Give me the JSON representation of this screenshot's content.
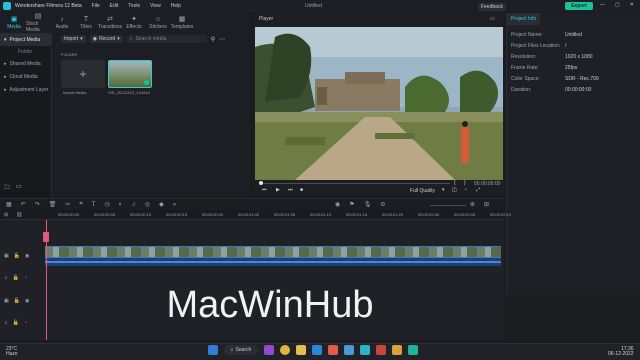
{
  "titlebar": {
    "app_name": "Wondershare Filmora 12 Beta",
    "menu": [
      "File",
      "Edit",
      "Tools",
      "View",
      "Help"
    ],
    "doc_title": "Untitled",
    "feedback": "Feedback",
    "export": "Export",
    "accent": "#17c39a"
  },
  "toptabs": [
    {
      "label": "Media",
      "icon": "media-icon"
    },
    {
      "label": "Stock Media",
      "icon": "stock-media-icon"
    },
    {
      "label": "Audio",
      "icon": "music-note-icon"
    },
    {
      "label": "Titles",
      "icon": "text-icon"
    },
    {
      "label": "Transitions",
      "icon": "transition-icon"
    },
    {
      "label": "Effects",
      "icon": "effects-icon"
    },
    {
      "label": "Stickers",
      "icon": "sticker-icon"
    },
    {
      "label": "Templates",
      "icon": "template-icon"
    }
  ],
  "leftnav": {
    "project_media": "Project Media",
    "folder": "Folder",
    "shared_media": "Shared Media",
    "cloud_media": "Cloud Media",
    "adjustment_layer": "Adjustment Layer"
  },
  "media": {
    "import_btn": "Import",
    "record_btn": "Record",
    "search_placeholder": "Search media",
    "folder_label": "FOLDER",
    "import_tile_label": "Import Media",
    "clip_label": "VID_20221112_144416"
  },
  "player": {
    "title": "Player",
    "timecode": "00:00:00:00",
    "quality": "Full Quality"
  },
  "properties": {
    "tab": "Project Info",
    "rows": [
      {
        "k": "Project Name:",
        "v": "Untitled"
      },
      {
        "k": "Project Files Location:",
        "v": "/"
      },
      {
        "k": "Resolution:",
        "v": "1920 x 1080"
      },
      {
        "k": "Frame Rate:",
        "v": "25fps"
      },
      {
        "k": "Color Space:",
        "v": "SDR - Rec.709"
      },
      {
        "k": "Duration:",
        "v": "00:00:00:00"
      }
    ]
  },
  "timeline": {
    "ruler": [
      "00:00:00:00",
      "00:00:00:05",
      "00:00:00:10",
      "00:00:00:15",
      "00:00:00:20",
      "00:00:01:00",
      "00:00:01:05",
      "00:00:01:10",
      "00:00:01:15",
      "00:00:01:20",
      "00:00:02:00",
      "00:00:02:05",
      "00:00:02:10"
    ]
  },
  "watermark": "MacWinHub",
  "taskbar": {
    "temp": "23°C",
    "weather": "Haze",
    "search": "Search",
    "time": "17:36",
    "date": "06-12-2022"
  }
}
